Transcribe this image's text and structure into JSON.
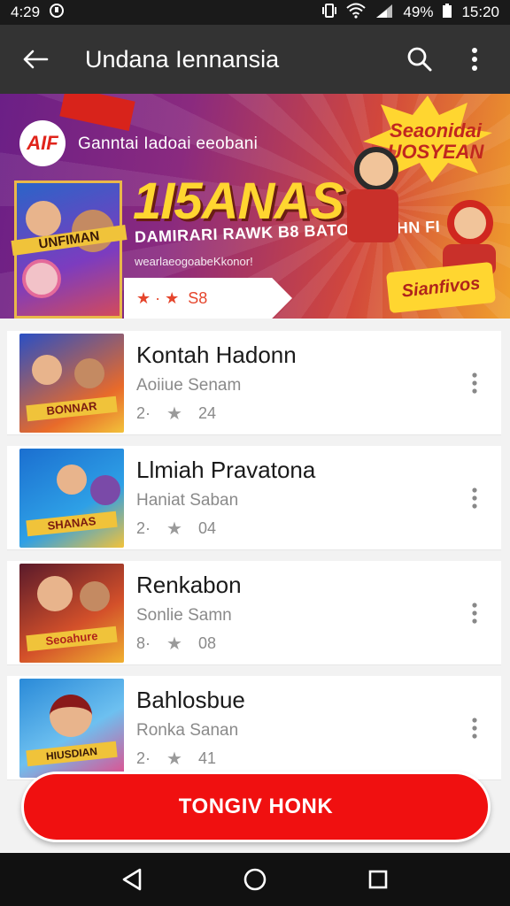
{
  "status_bar": {
    "time": "4:29",
    "battery": "49%",
    "clock": "15:20"
  },
  "app_bar": {
    "title": "Undana Iennansia"
  },
  "banner": {
    "logo_text": "AIF",
    "subtitle": "Ganntai Iadoai eeobani",
    "headline": "1I5ANAS",
    "tagline": "DAMIRARI RAWK B8 BATOARASHN FI",
    "small_text": "wearlaeogoabeKkonor!",
    "rating_stars": "★ · ★",
    "rating_count": "S8",
    "burst_text": "Seaonidai UOSYEAN",
    "corner_badge": "Sianfivos",
    "poster_label": "UNFIMAN"
  },
  "items": [
    {
      "title": "Kontah Hadonn",
      "author": "Aoiiue Senam",
      "rank": "2·",
      "count": "24",
      "thumb_label": "BONNAR",
      "colors": [
        "#2a4fc4",
        "#e86a2a",
        "#f2c23a"
      ]
    },
    {
      "title": "Llmiah Pravatona",
      "author": "Haniat Saban",
      "rank": "2·",
      "count": "04",
      "thumb_label": "SHANAS",
      "colors": [
        "#1b6fd0",
        "#2ea0e6",
        "#f2c23a"
      ]
    },
    {
      "title": "Renkabon",
      "author": "Sonlie Samn",
      "rank": "8·",
      "count": "08",
      "thumb_label": "Seoahure",
      "colors": [
        "#5a1a2a",
        "#d3502a",
        "#f0b030"
      ]
    },
    {
      "title": "Bahlosbue",
      "author": "Ronka Sanan",
      "rank": "2·",
      "count": "41",
      "thumb_label": "HIUSDIAN",
      "colors": [
        "#2a8ad8",
        "#6dc0f0",
        "#e44c8c"
      ]
    }
  ],
  "cta": {
    "label": "TONGIV HONK"
  }
}
